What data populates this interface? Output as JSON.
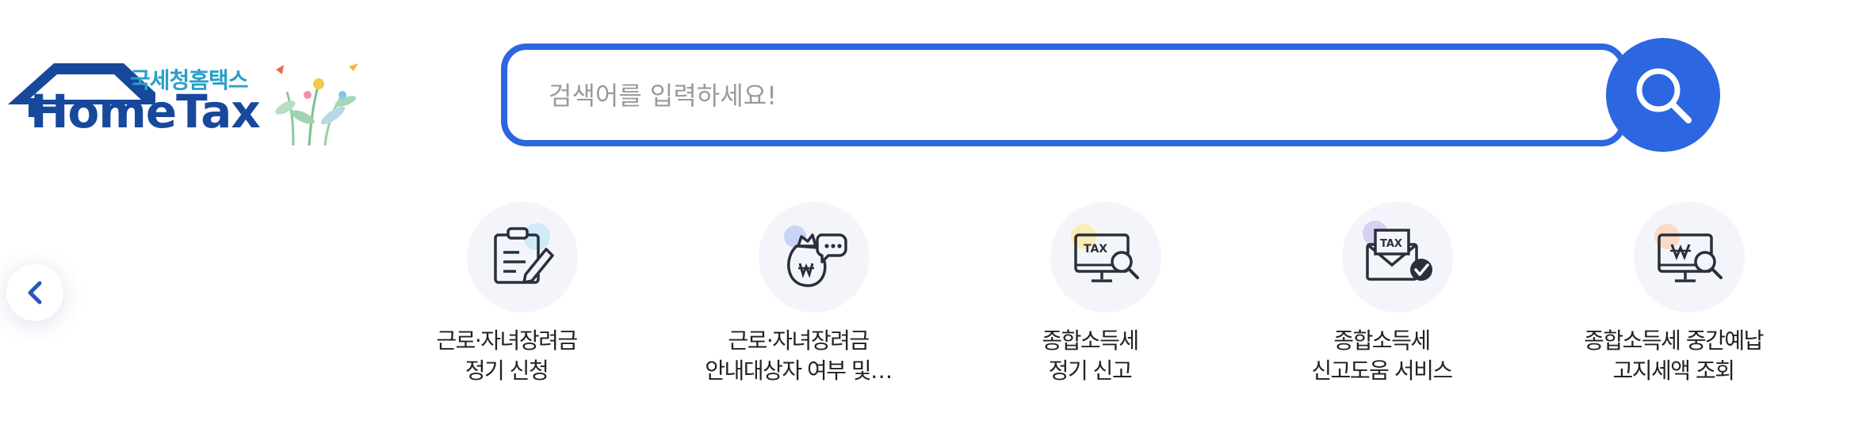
{
  "logo": {
    "small_text": "국세청홈택스",
    "big_text": "HomeTax"
  },
  "search": {
    "placeholder": "검색어를 입력하세요!"
  },
  "colors": {
    "brand_blue": "#2c66e0",
    "logo_navy": "#17489b",
    "logo_teal": "#2a9fc9",
    "icon_bg": "#f3f5fa"
  },
  "carousel": {
    "prev_icon": "chevron-left-icon",
    "items": [
      {
        "icon": "clipboard-pen-icon",
        "line1": "근로·자녀장려금",
        "line2": "정기 신청"
      },
      {
        "icon": "money-bag-chat-icon",
        "line1": "근로·자녀장려금",
        "line2": "안내대상자 여부 및…"
      },
      {
        "icon": "tax-monitor-search-icon",
        "line1": "종합소득세",
        "line2": "정기 신고"
      },
      {
        "icon": "tax-envelope-check-icon",
        "line1": "종합소득세",
        "line2": "신고도움 서비스"
      },
      {
        "icon": "won-monitor-search-icon",
        "line1": "종합소득세 중간예납",
        "line2": "고지세액 조회"
      }
    ]
  }
}
